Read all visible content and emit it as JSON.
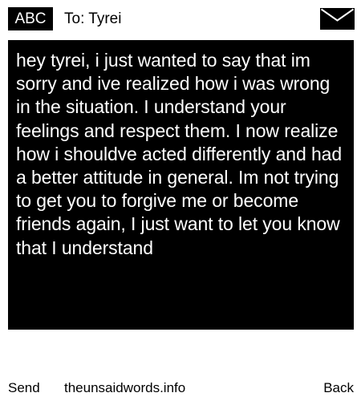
{
  "header": {
    "mode_label": "ABC",
    "recipient": "To: Tyrei",
    "send_icon": "envelope-icon"
  },
  "message": {
    "body": "hey tyrei, i just wanted to say that im sorry and ive realized how i was wrong in the situation. I understand your feelings and respect them. I now realize how i shouldve acted differently and had a better attitude in general. Im not trying to get you to forgive me or become friends again, I just want to let you know that I understand"
  },
  "footer": {
    "send_label": "Send",
    "site_label": "theunsaidwords.info",
    "back_label": "Back"
  },
  "colors": {
    "background": "#ffffff",
    "message_background": "#000000",
    "message_text": "#ffffff",
    "text": "#000000"
  }
}
